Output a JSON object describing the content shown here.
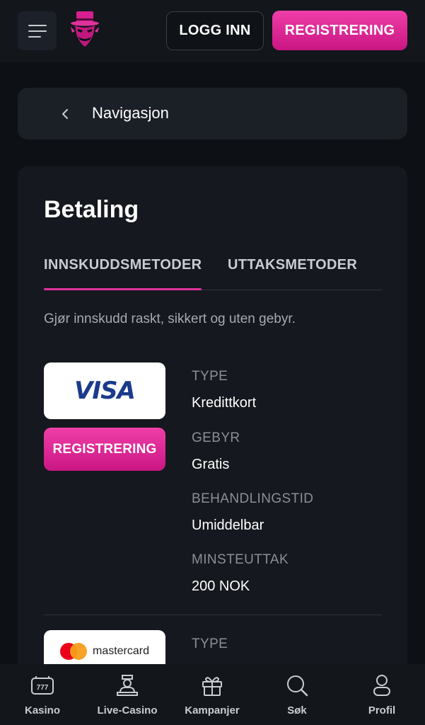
{
  "header": {
    "login_label": "LOGG INN",
    "register_label": "REGISTRERING"
  },
  "nav": {
    "label": "Navigasjon"
  },
  "page": {
    "title": "Betaling",
    "tabs": [
      {
        "label": "INNSKUDDSMETODER",
        "active": true
      },
      {
        "label": "UTTAKSMETODER",
        "active": false
      }
    ],
    "intro": "Gjør innskudd raskt, sikkert og uten gebyr."
  },
  "methods": [
    {
      "logo": "VISA",
      "button_label": "REGISTRERING",
      "details": [
        {
          "label": "TYPE",
          "value": "Kredittkort"
        },
        {
          "label": "GEBYR",
          "value": "Gratis"
        },
        {
          "label": "BEHANDLINGSTID",
          "value": "Umiddelbar"
        },
        {
          "label": "MINSTEUTTAK",
          "value": "200 NOK"
        }
      ]
    },
    {
      "logo": "mastercard",
      "details": [
        {
          "label": "TYPE"
        }
      ]
    }
  ],
  "bottom_nav": [
    {
      "label": "Kasino",
      "icon": "slot-machine-icon"
    },
    {
      "label": "Live-Casino",
      "icon": "dealer-icon"
    },
    {
      "label": "Kampanjer",
      "icon": "gift-icon"
    },
    {
      "label": "Søk",
      "icon": "search-icon"
    },
    {
      "label": "Profil",
      "icon": "user-icon"
    }
  ],
  "colors": {
    "accent": "#e0329e",
    "background": "#0d1014",
    "card": "#15181e"
  }
}
